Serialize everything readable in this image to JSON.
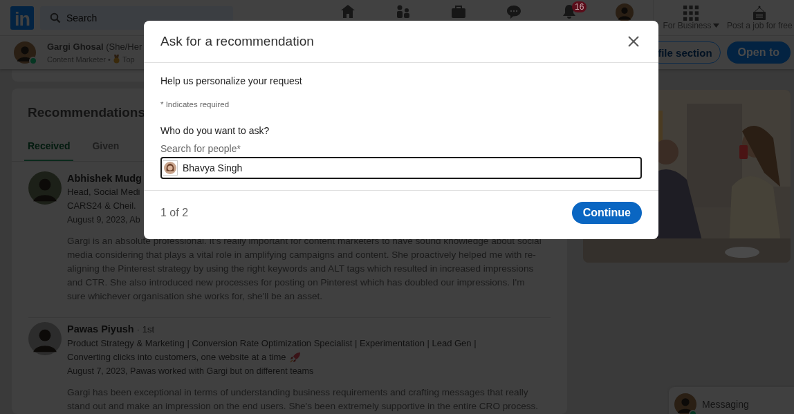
{
  "nav": {
    "logo": "in",
    "search": {
      "placeholder": "Search"
    },
    "notification_count": "16",
    "for_business": "For Business",
    "post_job": "Post a job for free"
  },
  "profile_bar": {
    "name": "Gargi Ghosal",
    "pronouns": "(She/Her",
    "headline": "Content Marketer •",
    "badge": "Top",
    "online": true,
    "buttons": [
      {
        "label": "file section",
        "kind": "outline"
      },
      {
        "label": "Open to",
        "kind": "primary"
      }
    ]
  },
  "recommendations": {
    "title": "Recommendations",
    "tabs": [
      {
        "label": "Received",
        "selected": true
      },
      {
        "label": "Given",
        "selected": false
      }
    ],
    "items": [
      {
        "name": "Abhishek Mudg",
        "headline_lines": [
          "Head, Social Medi",
          "CARS24 & Cheil."
        ],
        "date": "August 9, 2023, Ab",
        "text": "Gargi is an absolute professional. It's really important for content marketers to have sound knowledge about social media considering that plays a vital role in amplifying campaigns and content. She proactively helped me with re-aligning the Pinterest strategy by using the right keywords and ALT tags which resulted in increased impressions and CTR. She also introduced new processes for posting on Pinterest which has doubled our impressions. I'm sure whichever organisation she works for, she'll be an asset."
      },
      {
        "name": "Pawas Piyush",
        "degree": "· 1st",
        "headline_lines": [
          "Product Strategy & Marketing | Conversion Rate Optimization Specialist | Experimentation | Lead Gen |",
          "Converting clicks into customers, one website at a time"
        ],
        "trailing_icon": {
          "kind": "rocket"
        },
        "date": "August 7, 2023, Pawas worked with Gargi but on different teams",
        "text": "Gargi has been exceptional in terms of understanding business requirements and crafting messages that really stand out and make an impression on the end users. She's been extremely supportive in the entire CRO process."
      }
    ]
  },
  "messaging": {
    "label": "Messaging",
    "online": true
  },
  "modal": {
    "title": "Ask for a recommendation",
    "intro": "Help us personalize your request",
    "required_note": "* Indicates required",
    "question": "Who do you want to ask?",
    "field": {
      "label": "Search for people*",
      "value": "Bhavya Singh"
    },
    "step": "1 of 2",
    "primary_button": "Continue"
  }
}
